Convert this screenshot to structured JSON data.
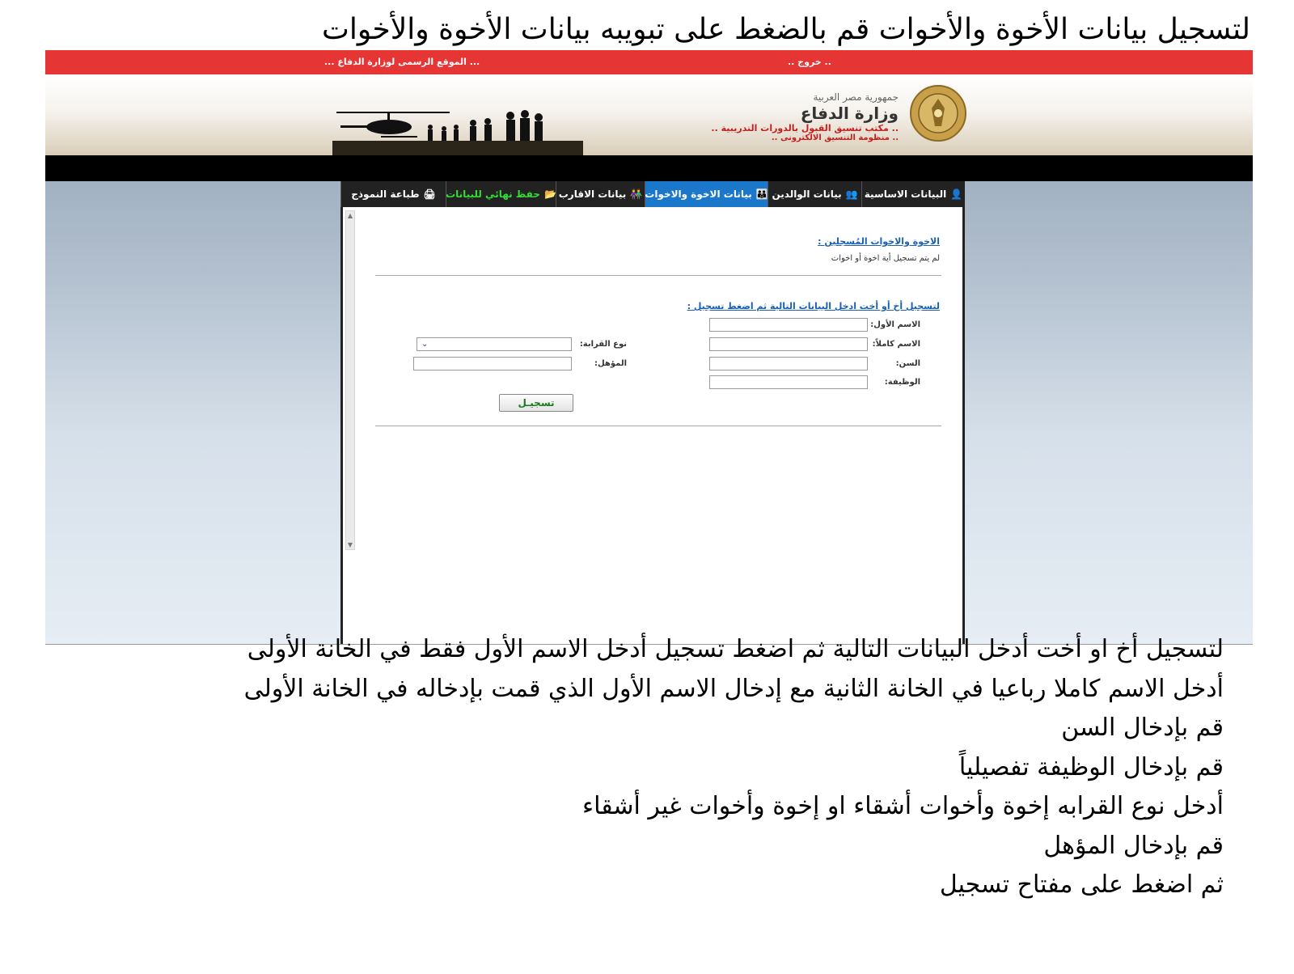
{
  "caption_top": "لتسجيل بيانات الأخوة والأخوات قم بالضغط على تبويبه بيانات الأخوة والأخوات",
  "topbar": {
    "exit": ".. خروج ..",
    "official_site": "... الموقع الرسمى لوزارة الدفاع ..."
  },
  "header": {
    "republic": "جمهورية مصر العربية",
    "ministry": "وزارة الدفاع",
    "office": ".. مكتب تنسيق القبول بالدورات التدريبية ..",
    "system": ".. منظومة التنسيق الالكترونى .."
  },
  "tabs": [
    {
      "label": "البيانات الاساسية",
      "icon": "person-icon"
    },
    {
      "label": "بيانات الوالدين",
      "icon": "parents-icon"
    },
    {
      "label": "بيانات الاخوة والاخوات",
      "icon": "siblings-icon",
      "active": true
    },
    {
      "label": "بيانات الاقارب",
      "icon": "relatives-icon"
    },
    {
      "label": "حفظ نهائي للبيانات",
      "icon": "folder-icon"
    },
    {
      "label": "طباعة النموذج",
      "icon": "printer-icon"
    }
  ],
  "registered": {
    "title": "الاخوة والاخوات المُسجلين :",
    "empty_message": "لم يتم تسجيل أية اخوة أو اخوات"
  },
  "form": {
    "title": "لتسجيل أخ أو أخت ادخل البيانات التالية ثم اضغط تسجيل :",
    "first_name_label": "الاسم الأول:",
    "full_name_label": "الاسم كاملاً:",
    "age_label": "السن:",
    "job_label": "الوظيفة:",
    "relation_label": "نوع القرابة:",
    "qualification_label": "المؤهل:",
    "submit_label": "تسجيـل",
    "first_name_value": "",
    "full_name_value": "",
    "age_value": "",
    "job_value": "",
    "relation_value": "",
    "qualification_value": ""
  },
  "instructions": [
    "لتسجيل أخ او أخت أدخل البيانات التالية ثم اضغط تسجيل أدخل الاسم الأول فقط في الخانة الأولى",
    "أدخل الاسم كاملا رباعيا في الخانة الثانية مع إدخال الاسم الأول الذي قمت بإدخاله في الخانة الأولى",
    "قم بإدخال السن",
    "قم بإدخال الوظيفة تفصيلياً",
    "أدخل نوع القرابه إخوة وأخوات أشقاء او إخوة وأخوات غير أشقاء",
    "قم بإدخال المؤهل",
    "ثم اضغط على مفتاح تسجيل"
  ]
}
